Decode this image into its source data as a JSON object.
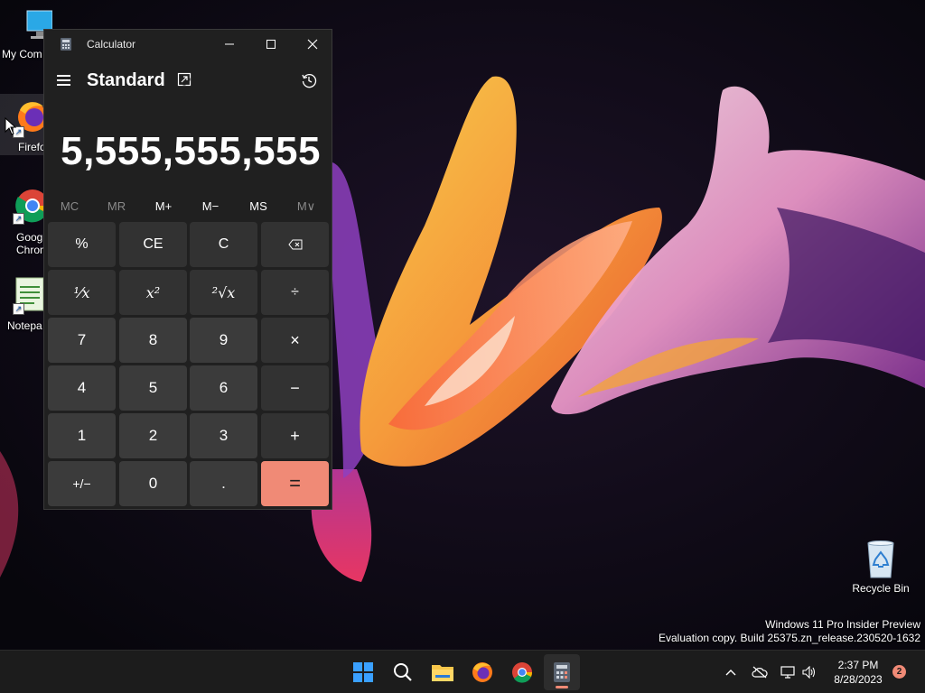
{
  "desktop": {
    "icons": [
      {
        "label": "My Com"
      },
      {
        "label": "Firefo"
      },
      {
        "label": "Goog"
      },
      {
        "label": "Chron"
      },
      {
        "label": "Notepa"
      }
    ],
    "recycle_bin": {
      "label": "Recycle Bin"
    },
    "watermark": {
      "line1": "Windows 11 Pro Insider Preview",
      "line2": "Evaluation copy. Build 25375.zn_release.230520-1632"
    }
  },
  "calculator": {
    "window_title": "Calculator",
    "mode": "Standard",
    "display_value": "5,555,555,555",
    "memory_buttons": [
      {
        "label": "MC",
        "enabled": false
      },
      {
        "label": "MR",
        "enabled": false
      },
      {
        "label": "M+",
        "enabled": true
      },
      {
        "label": "M−",
        "enabled": true
      },
      {
        "label": "MS",
        "enabled": true
      },
      {
        "label": "M∨",
        "enabled": false
      }
    ],
    "keys": {
      "percent": "%",
      "clear_entry": "CE",
      "clear": "C",
      "backspace": "⌫",
      "reciprocal": "¹⁄x",
      "square": "x²",
      "sqrt": "²√x",
      "divide": "÷",
      "seven": "7",
      "eight": "8",
      "nine": "9",
      "multiply": "×",
      "four": "4",
      "five": "5",
      "six": "6",
      "minus": "−",
      "one": "1",
      "two": "2",
      "three": "3",
      "plus": "+",
      "negate": "+/−",
      "zero": "0",
      "decimal": ".",
      "equals": "="
    },
    "accent_color": "#f08a76"
  },
  "taskbar": {
    "clock_time": "2:37 PM",
    "clock_date": "8/28/2023",
    "notification_count": "2",
    "pinned": [
      "start-icon",
      "search-icon",
      "file-explorer-icon",
      "firefox-icon",
      "chrome-icon",
      "calculator-icon"
    ]
  }
}
